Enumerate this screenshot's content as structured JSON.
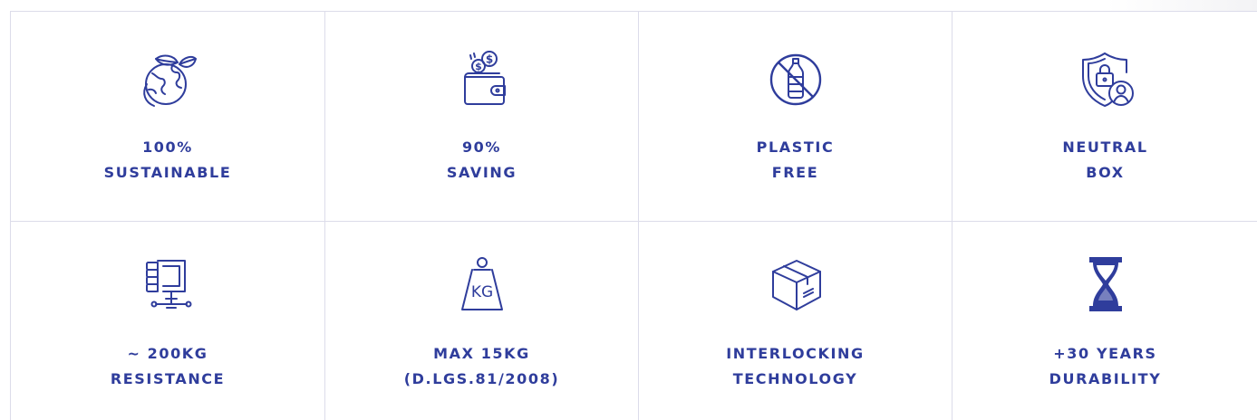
{
  "colors": {
    "accent": "#2f3d9c",
    "grid_line": "#dcdcea",
    "background": "#ffffff"
  },
  "features": [
    {
      "icon": "earth-leaves-icon",
      "line1": "100%",
      "line2": "SUSTAINABLE"
    },
    {
      "icon": "wallet-coins-icon",
      "line1": "90%",
      "line2": "SAVING"
    },
    {
      "icon": "no-plastic-bottle-icon",
      "line1": "PLASTIC",
      "line2": "FREE"
    },
    {
      "icon": "shield-user-lock-icon",
      "line1": "NEUTRAL",
      "line2": "BOX"
    },
    {
      "icon": "clamp-press-icon",
      "line1": "~ 200KG",
      "line2": "RESISTANCE"
    },
    {
      "icon": "kg-weight-icon",
      "line1": "MAX 15KG",
      "line2": "(D.LGS.81/2008)"
    },
    {
      "icon": "cardboard-box-icon",
      "line1": "INTERLOCKING",
      "line2": "TECHNOLOGY"
    },
    {
      "icon": "hourglass-icon",
      "line1": "+30 YEARS",
      "line2": "DURABILITY"
    }
  ]
}
